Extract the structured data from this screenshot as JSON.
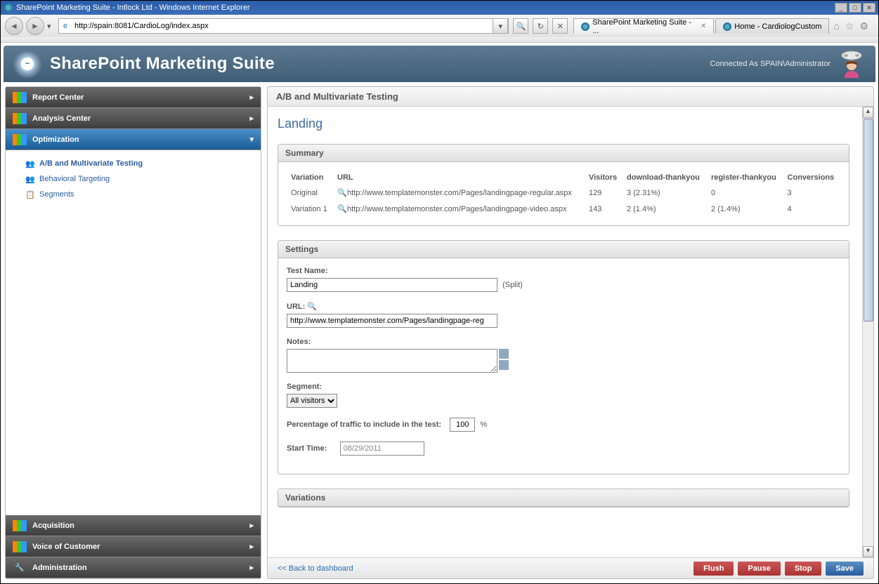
{
  "window": {
    "title": "SharePoint Marketing Suite - Intlock Ltd - Windows Internet Explorer",
    "url": "http://spain:8081/CardioLog/index.aspx"
  },
  "tabs": [
    {
      "label": "SharePoint Marketing Suite - ...",
      "active": true,
      "closable": true
    },
    {
      "label": "Home - CardiologCustom",
      "active": false,
      "closable": false
    }
  ],
  "app": {
    "title": "SharePoint Marketing Suite",
    "connected_as": "Connected As SPAIN\\Administrator"
  },
  "sidebar": {
    "top_sections": [
      {
        "label": "Report Center",
        "icon": "bars"
      },
      {
        "label": "Analysis Center",
        "icon": "gear"
      }
    ],
    "active_section": {
      "label": "Optimization",
      "icon": "opt"
    },
    "subitems": [
      {
        "label": "A/B and Multivariate Testing",
        "active": true
      },
      {
        "label": "Behavioral Targeting",
        "active": false
      },
      {
        "label": "Segments",
        "active": false
      }
    ],
    "bottom_sections": [
      {
        "label": "Acquisition"
      },
      {
        "label": "Voice of Customer"
      },
      {
        "label": "Administration"
      }
    ]
  },
  "content": {
    "heading": "A/B and Multivariate Testing",
    "page_title": "Landing",
    "summary": {
      "title": "Summary",
      "columns": [
        "Variation",
        "URL",
        "Visitors",
        "download-thankyou",
        "register-thankyou",
        "Conversions"
      ],
      "rows": [
        {
          "variation": "Original",
          "url": "http://www.templatemonster.com/Pages/landingpage-regular.aspx",
          "visitors": "129",
          "c1": "3 (2.31%)",
          "c2": "0",
          "conv": "3"
        },
        {
          "variation": "Variation 1",
          "url": "http://www.templatemonster.com/Pages/landingpage-video.aspx",
          "visitors": "143",
          "c1": "2 (1.4%)",
          "c2": "2 (1.4%)",
          "conv": "4"
        }
      ]
    },
    "settings": {
      "title": "Settings",
      "test_name_label": "Test Name:",
      "test_name_value": "Landing",
      "test_name_suffix": "(Split)",
      "url_label": "URL:",
      "url_value": "http://www.templatemonster.com/Pages/landingpage-reg",
      "notes_label": "Notes:",
      "segment_label": "Segment:",
      "segment_value": "All visitors",
      "pct_label": "Percentage of traffic to include in the test:",
      "pct_value": "100",
      "pct_suffix": "%",
      "start_label": "Start Time:",
      "start_value": "08/29/2011"
    },
    "variations_title": "Variations"
  },
  "footer": {
    "back": "<< Back to dashboard",
    "buttons": [
      "Flush",
      "Pause",
      "Stop",
      "Save"
    ]
  }
}
